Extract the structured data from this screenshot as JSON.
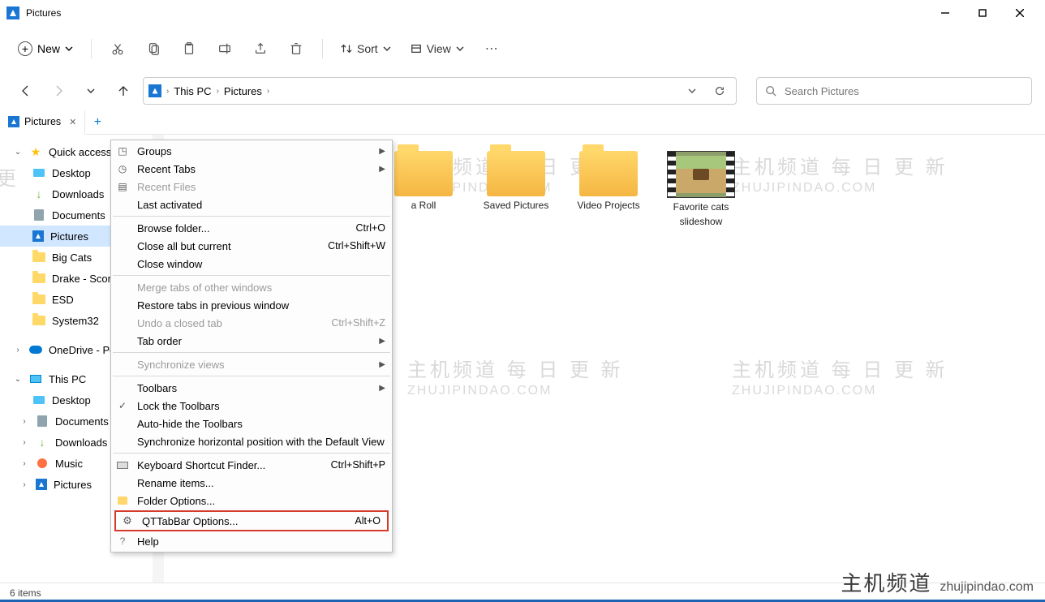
{
  "window": {
    "title": "Pictures"
  },
  "toolbar": {
    "new": "New",
    "sort": "Sort",
    "view": "View"
  },
  "breadcrumb": {
    "root": "This PC",
    "current": "Pictures"
  },
  "search": {
    "placeholder": "Search Pictures"
  },
  "tab": {
    "label": "Pictures"
  },
  "sidebar": {
    "quick": "Quick access",
    "desk": "Desktop",
    "down": "Downloads",
    "docs": "Documents",
    "pics": "Pictures",
    "bigcats": "Big Cats",
    "drake": "Drake - Scorp",
    "esd": "ESD",
    "sys32": "System32",
    "onedrive": "OneDrive - Per",
    "thispc": "This PC",
    "pc_desk": "Desktop",
    "pc_docs": "Documents",
    "pc_down": "Downloads",
    "pc_music": "Music",
    "pc_pics": "Pictures"
  },
  "items": {
    "roll": "a Roll",
    "saved": "Saved Pictures",
    "video": "Video Projects",
    "fav1": "Favorite cats",
    "fav2": "slideshow"
  },
  "menu": {
    "groups": "Groups",
    "recent_tabs": "Recent Tabs",
    "recent_files": "Recent Files",
    "last_act": "Last activated",
    "browse": "Browse folder...",
    "browse_sc": "Ctrl+O",
    "close_all": "Close all but current",
    "close_all_sc": "Ctrl+Shift+W",
    "close_win": "Close window",
    "merge": "Merge tabs of other windows",
    "restore": "Restore tabs in previous window",
    "undo": "Undo a closed tab",
    "undo_sc": "Ctrl+Shift+Z",
    "taborder": "Tab order",
    "sync": "Synchronize views",
    "toolbars": "Toolbars",
    "lock": "Lock the Toolbars",
    "autohide": "Auto-hide the Toolbars",
    "synchpos": "Synchronize horizontal position with the Default View",
    "kbfind": "Keyboard Shortcut Finder...",
    "kbfind_sc": "Ctrl+Shift+P",
    "rename": "Rename items...",
    "folder_opt": "Folder Options...",
    "qtopt": "QTTabBar Options...",
    "qtopt_sc": "Alt+O",
    "help": "Help"
  },
  "wm": {
    "cn": "主机频道 每 日 更 新",
    "en": "ZHUJIPINDAO.COM",
    "edge1": "更",
    "edge2": "CO"
  },
  "status": {
    "count": "6 items"
  },
  "brand": {
    "cn": "主机频道",
    "en": "zhujipindao.com"
  }
}
